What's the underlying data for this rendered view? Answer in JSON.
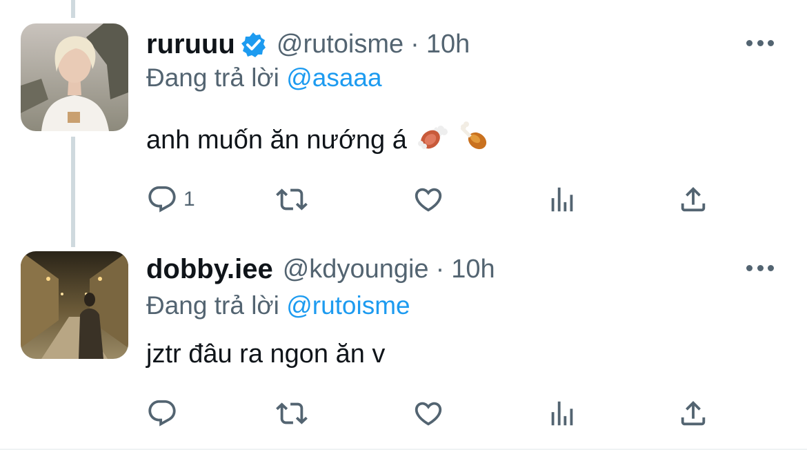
{
  "tweets": [
    {
      "display_name": "ruruuu",
      "verified": true,
      "handle": "@rutoisme",
      "separator": "·",
      "time": "10h",
      "replying_prefix": "Đang trả lời",
      "replying_to": "@asaaa",
      "text": "anh muốn ăn nướng á",
      "emojis": [
        "meat-on-bone",
        "poultry-leg"
      ],
      "reply_count": "1"
    },
    {
      "display_name": "dobby.iee",
      "verified": false,
      "handle": "@kdyoungie",
      "separator": "·",
      "time": "10h",
      "replying_prefix": "Đang trả lời",
      "replying_to": "@rutoisme",
      "text": "jztr đâu ra ngon ăn v",
      "reply_count": ""
    }
  ],
  "colors": {
    "accent": "#1d9bf0",
    "secondary_text": "#536471",
    "thread_line": "#cfd9de"
  }
}
